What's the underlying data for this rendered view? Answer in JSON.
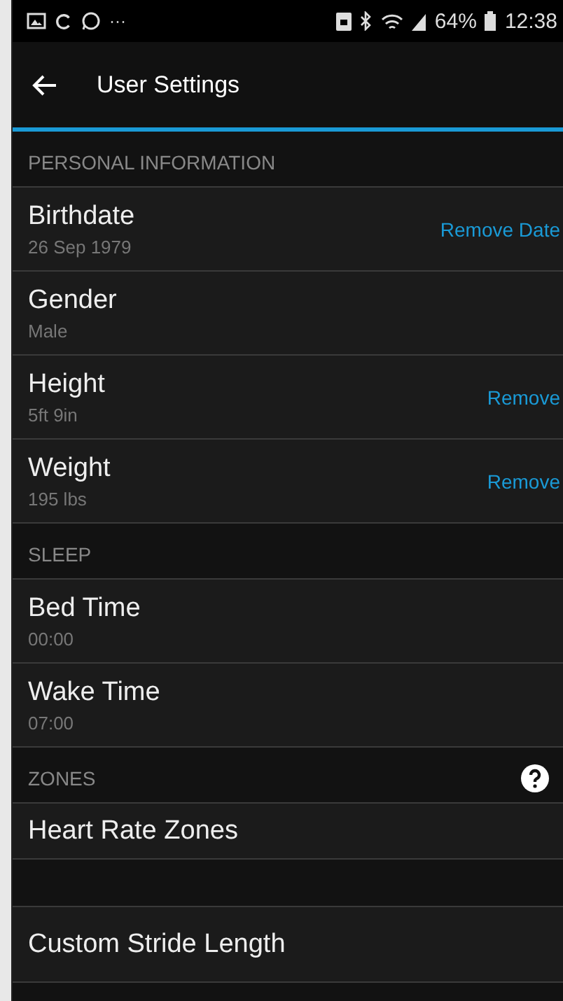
{
  "status_bar": {
    "more": "···",
    "battery": "64%",
    "time": "12:38"
  },
  "app_bar": {
    "title": "User Settings"
  },
  "items": [
    {
      "kind": "header",
      "label": "PERSONAL INFORMATION",
      "help": false
    },
    {
      "kind": "row",
      "title": "Birthdate",
      "value": "26 Sep 1979",
      "action": "Remove Date"
    },
    {
      "kind": "row",
      "title": "Gender",
      "value": "Male"
    },
    {
      "kind": "row",
      "title": "Height",
      "value": "5ft 9in",
      "action": "Remove"
    },
    {
      "kind": "row",
      "title": "Weight",
      "value": "195 lbs",
      "action": "Remove"
    },
    {
      "kind": "header",
      "label": "SLEEP",
      "help": false
    },
    {
      "kind": "row",
      "title": "Bed Time",
      "value": "00:00"
    },
    {
      "kind": "row",
      "title": "Wake Time",
      "value": "07:00"
    },
    {
      "kind": "header",
      "label": "ZONES",
      "help": true
    },
    {
      "kind": "row",
      "title": "Heart Rate Zones"
    },
    {
      "kind": "spacer"
    },
    {
      "kind": "row",
      "title": "Custom Stride Length"
    }
  ]
}
